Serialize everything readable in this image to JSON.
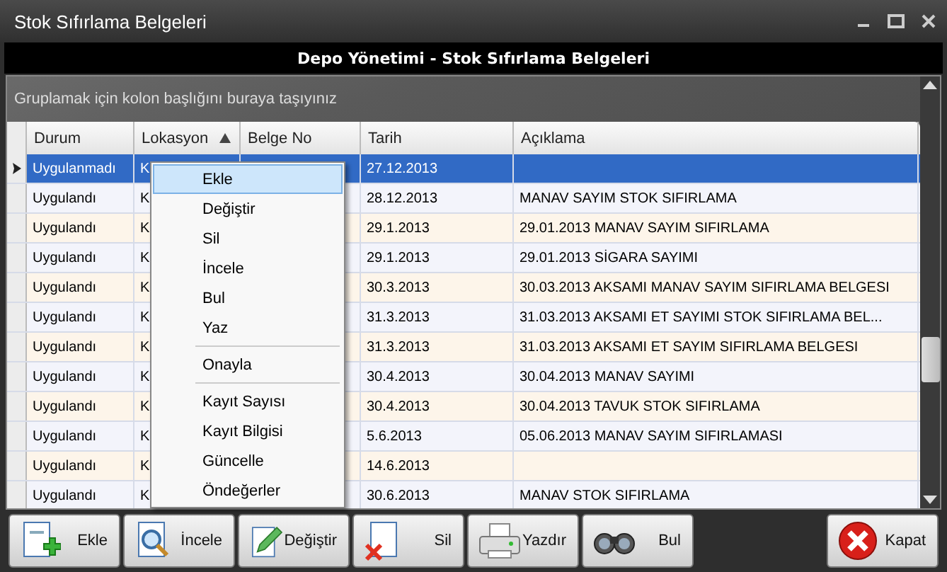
{
  "window": {
    "title": "Stok Sıfırlama Belgeleri"
  },
  "header": "Depo Yönetimi - Stok Sıfırlama Belgeleri",
  "group_panel": "Gruplamak için kolon başlığını buraya taşıyınız",
  "columns": [
    {
      "label": "Durum",
      "sorted": false
    },
    {
      "label": "Lokasyon",
      "sorted": true
    },
    {
      "label": "Belge No",
      "sorted": false
    },
    {
      "label": "Tarih",
      "sorted": false
    },
    {
      "label": "Açıklama",
      "sorted": false
    }
  ],
  "rows": [
    {
      "selected": true,
      "durum": "Uygulanmadı",
      "lokasyon": "K",
      "tarih": "27.12.2013",
      "aciklama": ""
    },
    {
      "selected": false,
      "durum": "Uygulandı",
      "lokasyon": "K",
      "tarih": "28.12.2013",
      "aciklama": "MANAV SAYIM STOK SIFIRLAMA"
    },
    {
      "selected": false,
      "durum": "Uygulandı",
      "lokasyon": "K",
      "tarih": "29.1.2013",
      "aciklama": "29.01.2013 MANAV SAYIM SIFIRLAMA"
    },
    {
      "selected": false,
      "durum": "Uygulandı",
      "lokasyon": "K",
      "tarih": "29.1.2013",
      "aciklama": "29.01.2013 SİGARA SAYIMI"
    },
    {
      "selected": false,
      "durum": "Uygulandı",
      "lokasyon": "K",
      "tarih": "30.3.2013",
      "aciklama": "30.03.2013 AKSAMI MANAV SAYIM SIFIRLAMA BELGESI"
    },
    {
      "selected": false,
      "durum": "Uygulandı",
      "lokasyon": "K",
      "tarih": "31.3.2013",
      "aciklama": "31.03.2013 AKSAMI ET SAYIMI STOK SIFIRLAMA  BEL..."
    },
    {
      "selected": false,
      "durum": "Uygulandı",
      "lokasyon": "K",
      "tarih": "31.3.2013",
      "aciklama": "31.03.2013 AKSAMI ET SAYIM SIFIRLAMA BELGESI"
    },
    {
      "selected": false,
      "durum": "Uygulandı",
      "lokasyon": "K",
      "tarih": "30.4.2013",
      "aciklama": "30.04.2013 MANAV SAYIMI"
    },
    {
      "selected": false,
      "durum": "Uygulandı",
      "lokasyon": "K",
      "tarih": "30.4.2013",
      "aciklama": "30.04.2013 TAVUK STOK SIFIRLAMA"
    },
    {
      "selected": false,
      "durum": "Uygulandı",
      "lokasyon": "K",
      "tarih": "5.6.2013",
      "aciklama": "05.06.2013 MANAV SAYIM SIFIRLAMASI"
    },
    {
      "selected": false,
      "durum": "Uygulandı",
      "lokasyon": "K",
      "tarih": "14.6.2013",
      "aciklama": ""
    },
    {
      "selected": false,
      "durum": "Uygulandı",
      "lokasyon": "K",
      "tarih": "30.6.2013",
      "aciklama": "MANAV STOK SIFIRLAMA"
    }
  ],
  "context_menu": [
    {
      "label": "Ekle",
      "selected": true,
      "separator_after": false
    },
    {
      "label": "Değiştir",
      "selected": false,
      "separator_after": false
    },
    {
      "label": "Sil",
      "selected": false,
      "separator_after": false
    },
    {
      "label": "İncele",
      "selected": false,
      "separator_after": false
    },
    {
      "label": "Bul",
      "selected": false,
      "separator_after": false
    },
    {
      "label": "Yaz",
      "selected": false,
      "separator_after": true
    },
    {
      "label": "Onayla",
      "selected": false,
      "separator_after": true
    },
    {
      "label": "Kayıt Sayısı",
      "selected": false,
      "separator_after": false
    },
    {
      "label": "Kayıt Bilgisi",
      "selected": false,
      "separator_after": false
    },
    {
      "label": "Güncelle",
      "selected": false,
      "separator_after": false
    },
    {
      "label": "Öndeğerler",
      "selected": false,
      "separator_after": false
    }
  ],
  "toolbar": [
    {
      "kind": "add",
      "label": "Ekle"
    },
    {
      "kind": "inspect",
      "label": "İncele"
    },
    {
      "kind": "edit",
      "label": "Değiştir"
    },
    {
      "kind": "delete",
      "label": "Sil"
    },
    {
      "kind": "print",
      "label": "Yazdır"
    },
    {
      "kind": "find",
      "label": "Bul"
    },
    {
      "kind": "close",
      "label": "Kapat"
    }
  ]
}
